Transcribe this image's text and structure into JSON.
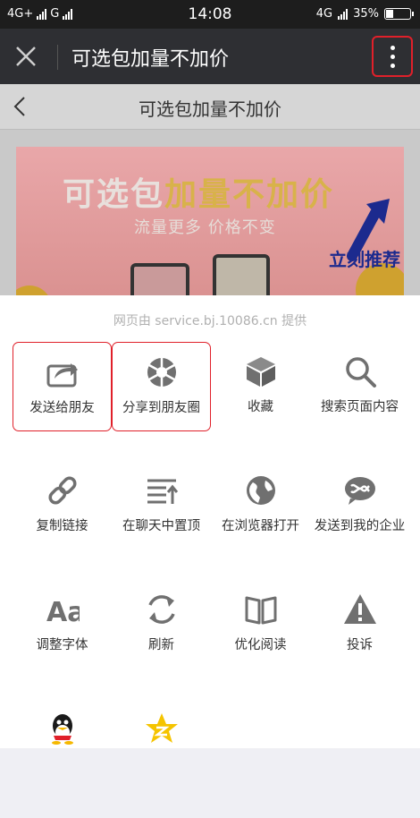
{
  "status": {
    "left_net1": "4G+",
    "left_net2": "G",
    "time": "14:08",
    "right_net": "4G",
    "battery_text": "35%",
    "battery_level": 0.35
  },
  "titlebar": {
    "title": "可选包加量不加价"
  },
  "webpage": {
    "nav_title": "可选包加量不加价",
    "banner_head_white": "可选包",
    "banner_head_yellow": "加量不加价",
    "banner_sub": "流量更多 价格不变",
    "banner_recommend": "立刻推荐"
  },
  "sheet": {
    "provider": "网页由 service.bj.10086.cn 提供",
    "items": [
      {
        "label": "发送给朋友",
        "icon": "share-icon"
      },
      {
        "label": "分享到朋友圈",
        "icon": "moments-icon"
      },
      {
        "label": "收藏",
        "icon": "favorite-cube-icon"
      },
      {
        "label": "搜索页面内容",
        "icon": "search-icon"
      },
      {
        "label": "复制链接",
        "icon": "link-icon"
      },
      {
        "label": "在聊天中置顶",
        "icon": "pin-top-icon"
      },
      {
        "label": "在浏览器打开",
        "icon": "globe-icon"
      },
      {
        "label": "发送到我的企业",
        "icon": "enterprise-chat-icon"
      },
      {
        "label": "调整字体",
        "icon": "font-icon"
      },
      {
        "label": "刷新",
        "icon": "refresh-icon"
      },
      {
        "label": "优化阅读",
        "icon": "book-icon"
      },
      {
        "label": "投诉",
        "icon": "warning-icon"
      }
    ],
    "extra_icons": [
      "qq-icon",
      "qzone-icon"
    ]
  }
}
